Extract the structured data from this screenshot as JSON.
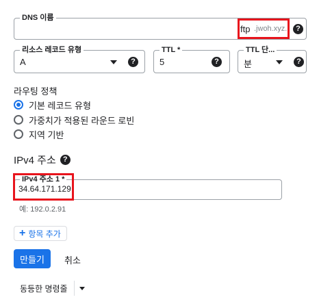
{
  "dns_name": {
    "label": "DNS 이름",
    "value_prefix": "ftp",
    "suffix": ".jwoh.xyz."
  },
  "record_type": {
    "label": "리소스 레코드 유형",
    "value": "A"
  },
  "ttl": {
    "label": "TTL *",
    "value": "5"
  },
  "ttl_unit": {
    "label": "TTL 단...",
    "value": "분"
  },
  "routing_policy": {
    "label": "라우팅 정책",
    "options": [
      {
        "label": "기본 레코드 유형",
        "checked": true
      },
      {
        "label": "가중치가 적용된 라운드 로빈",
        "checked": false
      },
      {
        "label": "지역 기반",
        "checked": false
      }
    ]
  },
  "ipv4_section": {
    "title": "IPv4 주소",
    "field_label": "IPv4 주소 1 *",
    "value": "34.64.171.129",
    "hint": "예: 192.0.2.91"
  },
  "add_item_button": {
    "label": "항목 추가"
  },
  "create_button": {
    "label": "만들기"
  },
  "cancel_button": {
    "label": "취소"
  },
  "equivalent_command": {
    "label": "동등한 명령줄"
  },
  "colors": {
    "accent": "#1a73e8",
    "highlight": "#e8141c",
    "border": "#9aa0a6"
  }
}
